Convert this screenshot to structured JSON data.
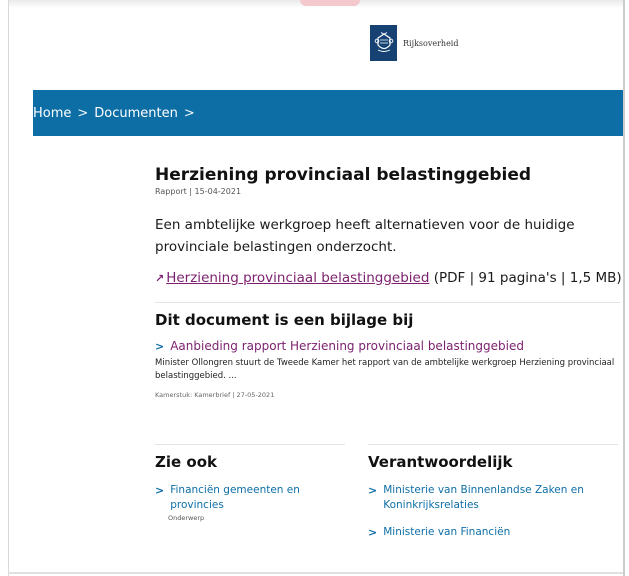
{
  "header": {
    "logo_text": "Rijksoverheid"
  },
  "breadcrumb": {
    "items": [
      "Home",
      "Documenten"
    ],
    "separator": ">"
  },
  "document": {
    "title": "Herziening provinciaal belastinggebied",
    "meta": "Rapport | 15-04-2021",
    "lead": "Een ambtelijke werkgroep heeft alternatieven voor de huidige provinciale belastingen onderzocht.",
    "download": {
      "arrow": "↗",
      "label": "Herziening provinciaal belastinggebied",
      "info": "(PDF | 91 pagina's | 1,5 MB)"
    }
  },
  "annex": {
    "heading": "Dit document is een bijlage bij",
    "chevron": ">",
    "link_label": "Aanbieding rapport Herziening provinciaal belastinggebied",
    "description": "Minister Ollongren stuurt de Tweede Kamer het rapport van de ambtelijke werkgroep Herziening provinciaal belastinggebied. ...",
    "meta": "Kamerstuk: Kamerbrief | 27-05-2021"
  },
  "see_also": {
    "heading": "Zie ook",
    "items": [
      {
        "label": "Financiën gemeenten en provincies",
        "sub": "Onderwerp"
      }
    ]
  },
  "responsible": {
    "heading": "Verantwoordelijk",
    "items": [
      {
        "label": "Ministerie van Binnenlandse Zaken en Koninkrijksrelaties"
      },
      {
        "label": "Ministerie van Financiën"
      }
    ]
  },
  "colors": {
    "brand_blue": "#0d6ea6",
    "logo_navy": "#154273",
    "visited_link": "#7b1f6e"
  }
}
